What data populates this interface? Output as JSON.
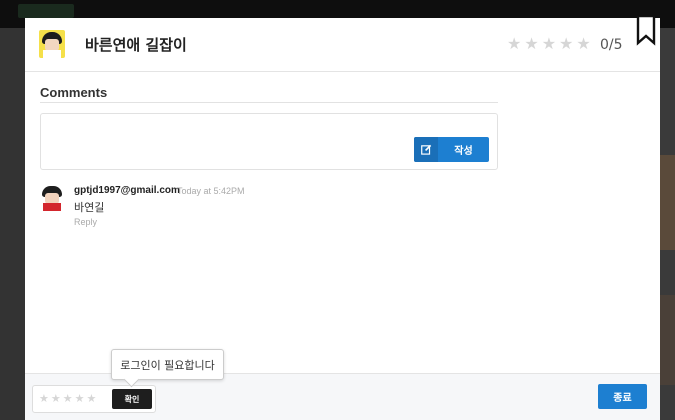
{
  "modal": {
    "title": "바른연애 길잡이",
    "rating_score": "0/5",
    "stars": [
      "★",
      "★",
      "★",
      "★",
      "★"
    ]
  },
  "comments": {
    "title": "Comments",
    "write_button_label": "작성",
    "items": [
      {
        "email": "gptjd1997@gmail.com",
        "time": "Today at 5:42PM",
        "text": "바연길",
        "reply_label": "Reply"
      }
    ]
  },
  "footer": {
    "stars": [
      "★",
      "★",
      "★",
      "★",
      "★"
    ],
    "confirm_label": "확인",
    "tooltip": "로그인이 필요합니다",
    "close_label": "종료"
  },
  "colors": {
    "accent": "#1d7fd1",
    "dark_button": "#1e1e1e",
    "star_empty": "#d6d6d6"
  },
  "icons": {
    "write": "edit-icon",
    "bookmark": "bookmark-icon",
    "star": "star-icon"
  }
}
